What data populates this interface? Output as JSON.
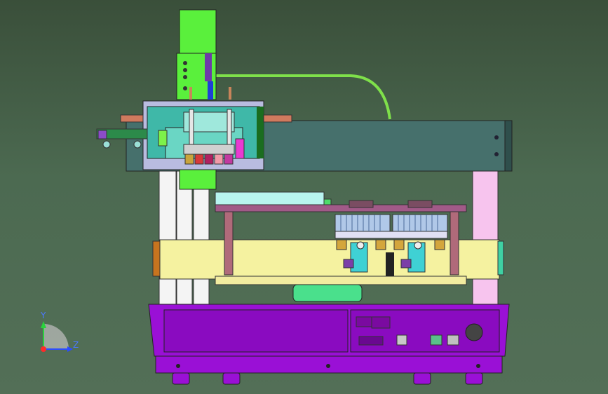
{
  "viewport": {
    "background_top": "#3a4f3a",
    "background_bottom": "#536f57"
  },
  "triad": {
    "y_label": "Y",
    "z_label": "Z",
    "y_color": "#29d33c",
    "z_color": "#2b4cff",
    "origin_color": "#ff2a2a"
  },
  "colors": {
    "gantry_beam": "#46706c",
    "head_green": "#5af03c",
    "carriage_plate": "#b9bce0",
    "valve_teal": "#3fb8a8",
    "base_purple": "#9a10d6",
    "fixture_yellow": "#f5f2a0",
    "column_pink": "#f7c4ee",
    "tube_green": "#7fe04a"
  }
}
